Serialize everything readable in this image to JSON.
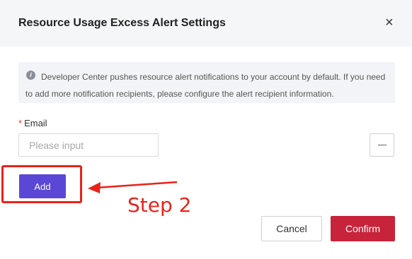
{
  "dialog": {
    "title": "Resource Usage Excess Alert Settings",
    "close_symbol": "×"
  },
  "notice": {
    "icon": "info-icon",
    "icon_glyph": "i",
    "text": "Developer Center pushes resource alert notifications to your account by default. If you need to add more notification recipients, please configure the alert recipient information."
  },
  "form": {
    "required_mark": "*",
    "email_label": "Email",
    "email_placeholder": "Please input",
    "email_value": "",
    "remove_icon": "minus-icon"
  },
  "actions": {
    "add_label": "Add",
    "cancel_label": "Cancel",
    "confirm_label": "Confirm"
  },
  "annotation": {
    "step_label": "Step 2",
    "color": "#e8231b"
  },
  "colors": {
    "primary": "#5b47d6",
    "confirm": "#c7233a",
    "header_bg": "#f5f6f8",
    "notice_bg": "#f2f4f7"
  }
}
